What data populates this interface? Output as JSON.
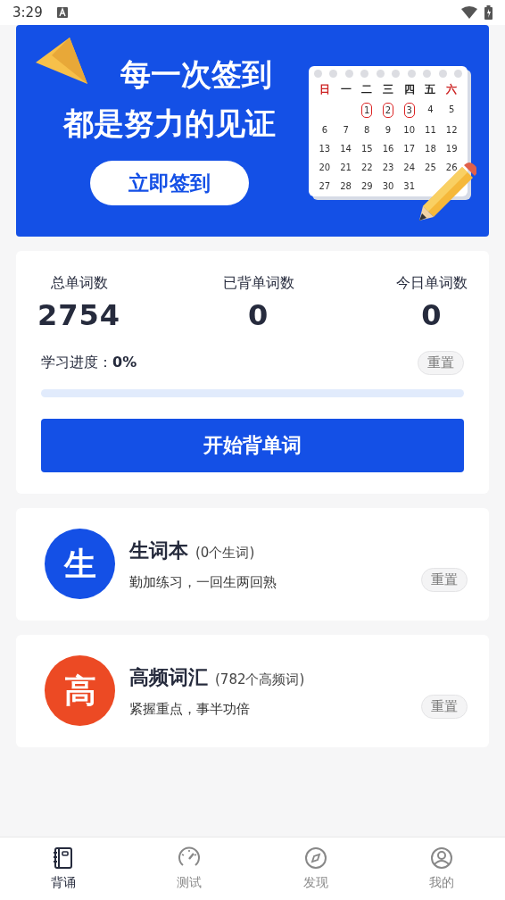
{
  "status_bar": {
    "time": "3:29"
  },
  "banner": {
    "headline": [
      "每一次签到",
      "都是努力的见证"
    ],
    "button": "立即签到",
    "calendar": {
      "weekdays": [
        {
          "label": "日",
          "weekend": true
        },
        {
          "label": "一",
          "weekend": false
        },
        {
          "label": "二",
          "weekend": false
        },
        {
          "label": "三",
          "weekend": false
        },
        {
          "label": "四",
          "weekend": false
        },
        {
          "label": "五",
          "weekend": false
        },
        {
          "label": "六",
          "weekend": true
        }
      ],
      "weeks": [
        [
          {
            "d": "1",
            "marked": true
          },
          {
            "d": "2",
            "marked": true
          },
          {
            "d": "3",
            "marked": true
          },
          {
            "d": "4",
            "marked": false
          },
          {
            "d": "5",
            "marked": false
          }
        ],
        [
          {
            "d": "6",
            "marked": false
          },
          {
            "d": "7",
            "marked": false
          },
          {
            "d": "8",
            "marked": false
          },
          {
            "d": "9",
            "marked": false
          },
          {
            "d": "10",
            "marked": false
          },
          {
            "d": "11",
            "marked": false
          },
          {
            "d": "12",
            "marked": false
          }
        ],
        [
          {
            "d": "13",
            "marked": false
          },
          {
            "d": "14",
            "marked": false
          },
          {
            "d": "15",
            "marked": false
          },
          {
            "d": "16",
            "marked": false
          },
          {
            "d": "17",
            "marked": false
          },
          {
            "d": "18",
            "marked": false
          },
          {
            "d": "19",
            "marked": false
          }
        ],
        [
          {
            "d": "20",
            "marked": false
          },
          {
            "d": "21",
            "marked": false
          },
          {
            "d": "22",
            "marked": false
          },
          {
            "d": "23",
            "marked": false
          },
          {
            "d": "24",
            "marked": false
          },
          {
            "d": "25",
            "marked": false
          },
          {
            "d": "26",
            "marked": false
          }
        ],
        [
          {
            "d": "27",
            "marked": false
          },
          {
            "d": "28",
            "marked": false
          },
          {
            "d": "29",
            "marked": false
          },
          {
            "d": "30",
            "marked": false
          },
          {
            "d": "31",
            "marked": false
          }
        ]
      ]
    }
  },
  "stats": [
    {
      "label": "总单词数",
      "value": "2754"
    },
    {
      "label": "已背单词数",
      "value": "0"
    },
    {
      "label": "今日单词数",
      "value": "0"
    }
  ],
  "progress": {
    "label": "学习进度：",
    "reading": "0%",
    "level": 0,
    "reset": "重置"
  },
  "start_button": "开始背单词",
  "lists": [
    {
      "badge": "生",
      "color": "#1450e6",
      "title": "生词本",
      "count": "(0个生词)",
      "subtitle": "勤加练习，一回生两回熟",
      "reset": "重置"
    },
    {
      "badge": "高",
      "color": "#ec4a24",
      "title": "高频词汇",
      "count": "(782个高频词)",
      "subtitle": "紧握重点，事半功倍",
      "reset": "重置"
    }
  ],
  "tab_bar": [
    {
      "kind": "notebook",
      "label": "背诵",
      "selected": true
    },
    {
      "kind": "gauge",
      "label": "测试",
      "selected": false
    },
    {
      "kind": "compass",
      "label": "发现",
      "selected": false
    },
    {
      "kind": "user",
      "label": "我的",
      "selected": false
    }
  ]
}
